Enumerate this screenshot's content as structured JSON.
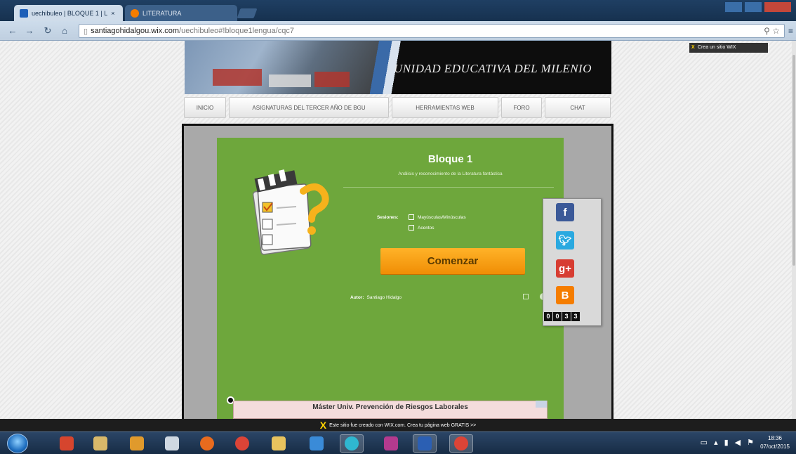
{
  "browser": {
    "tabs": [
      {
        "label": "uechibuleo | BLOQUE 1 | L",
        "active": true
      },
      {
        "label": "LITERATURA",
        "active": false
      }
    ],
    "url_host": "santiagohidalgou.wix.com",
    "url_path": "/uechibuleo#!bloque1lengua/cqc7",
    "user_badge": "1"
  },
  "page": {
    "wix_create_label": "Crea un sitio WIX",
    "banner_title": "UNIDAD EDUCATIVA DEL MILENIO",
    "nav": [
      "INICIO",
      "ASIGNATURAS DEL TERCER AÑO DE BGU",
      "HERRAMIENTAS WEB",
      "FORO",
      "CHAT"
    ],
    "quiz": {
      "title": "Bloque 1",
      "subtitle": "Análisis y reconocimiento de la Literatura fantástica",
      "sessions_label": "Sesiones:",
      "sessions": [
        "Mayúsculas/Minúsculas",
        "Acentos"
      ],
      "start_label": "Comenzar",
      "author_label": "Autor:",
      "author_name": "Santiago Hidalgo"
    },
    "share": {
      "count_digits": [
        "0",
        "0",
        "3",
        "3"
      ]
    },
    "ad_text": "Máster Univ. Prevención de Riesgos Laborales",
    "wix_banner": "Este sitio fue creado con WIX.com. Crea tu página web GRATIS >>"
  },
  "taskbar": {
    "time": "18:36",
    "date": "07/oct/2015"
  },
  "colors": {
    "quiz_green": "#6ea73c",
    "start_orange": "#f7a11a",
    "facebook": "#3b5998",
    "twitter": "#2aa9e0",
    "googleplus": "#d73d32",
    "blogger": "#f57d00"
  }
}
